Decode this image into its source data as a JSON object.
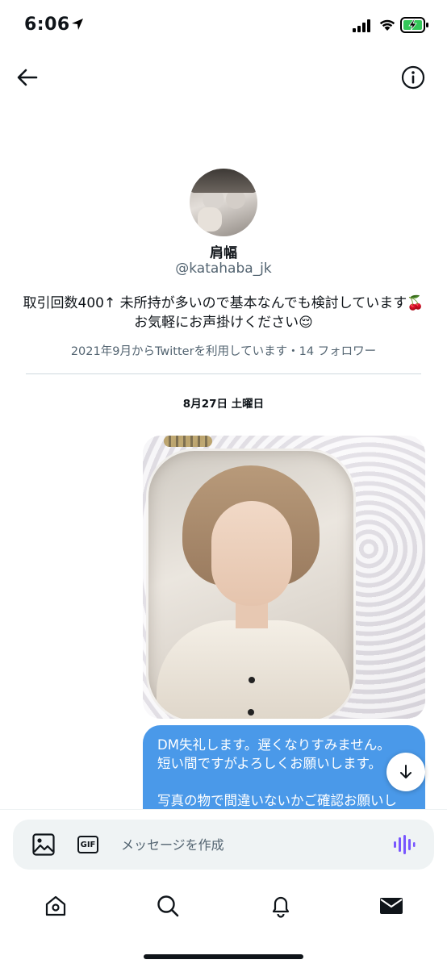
{
  "status_bar": {
    "time": "6:06"
  },
  "profile": {
    "display_name": "肩幅",
    "handle": "@katahaba_jk",
    "bio_line1": "取引回数400↑ 未所持が多いので基本なんでも検討しています🍒",
    "bio_line2": "お気軽にお声掛けください😌",
    "meta": "2021年9月からTwitterを利用しています・14 フォロワー"
  },
  "conversation": {
    "date_label": "8月27日 土曜日",
    "messages": [
      {
        "type": "text",
        "lines": [
          "DM失礼します。遅くなりすみません。",
          "短い間ですがよろしくお願いします。",
          "",
          "写真の物で間違いないかご確認お願いし"
        ]
      }
    ]
  },
  "composer": {
    "placeholder": "メッセージを作成",
    "gif_label": "GIF"
  },
  "colors": {
    "accent": "#1d9bf0",
    "bubble": "#4a99e9",
    "voice": "#7856ff",
    "text": "#0f1419",
    "muted": "#536471"
  },
  "icons": [
    "location-arrow-icon",
    "signal-icon",
    "wifi-icon",
    "battery-charging-icon",
    "back-arrow-icon",
    "info-icon",
    "arrow-down-icon",
    "image-icon",
    "gif-icon",
    "voice-wave-icon",
    "home-icon",
    "search-icon",
    "bell-icon",
    "mail-icon"
  ]
}
